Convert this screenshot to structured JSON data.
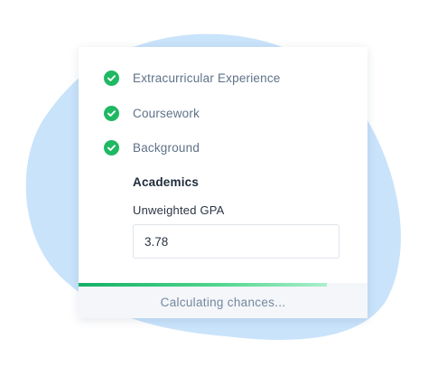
{
  "colors": {
    "blob": "#c9e3fb",
    "check": "#1fb863",
    "progress_start": "#13b066",
    "progress_end": "#a9f0cc",
    "footer_bg": "#f4f6f9"
  },
  "steps": [
    {
      "label": "Extracurricular Experience",
      "icon": "check-circle-icon",
      "completed": true
    },
    {
      "label": "Coursework",
      "icon": "check-circle-icon",
      "completed": true
    },
    {
      "label": "Background",
      "icon": "check-circle-icon",
      "completed": true
    }
  ],
  "academics": {
    "title": "Academics",
    "gpa_label": "Unweighted GPA",
    "gpa_value": "3.78"
  },
  "progress": {
    "fraction": 0.86,
    "status_text": "Calculating chances..."
  }
}
